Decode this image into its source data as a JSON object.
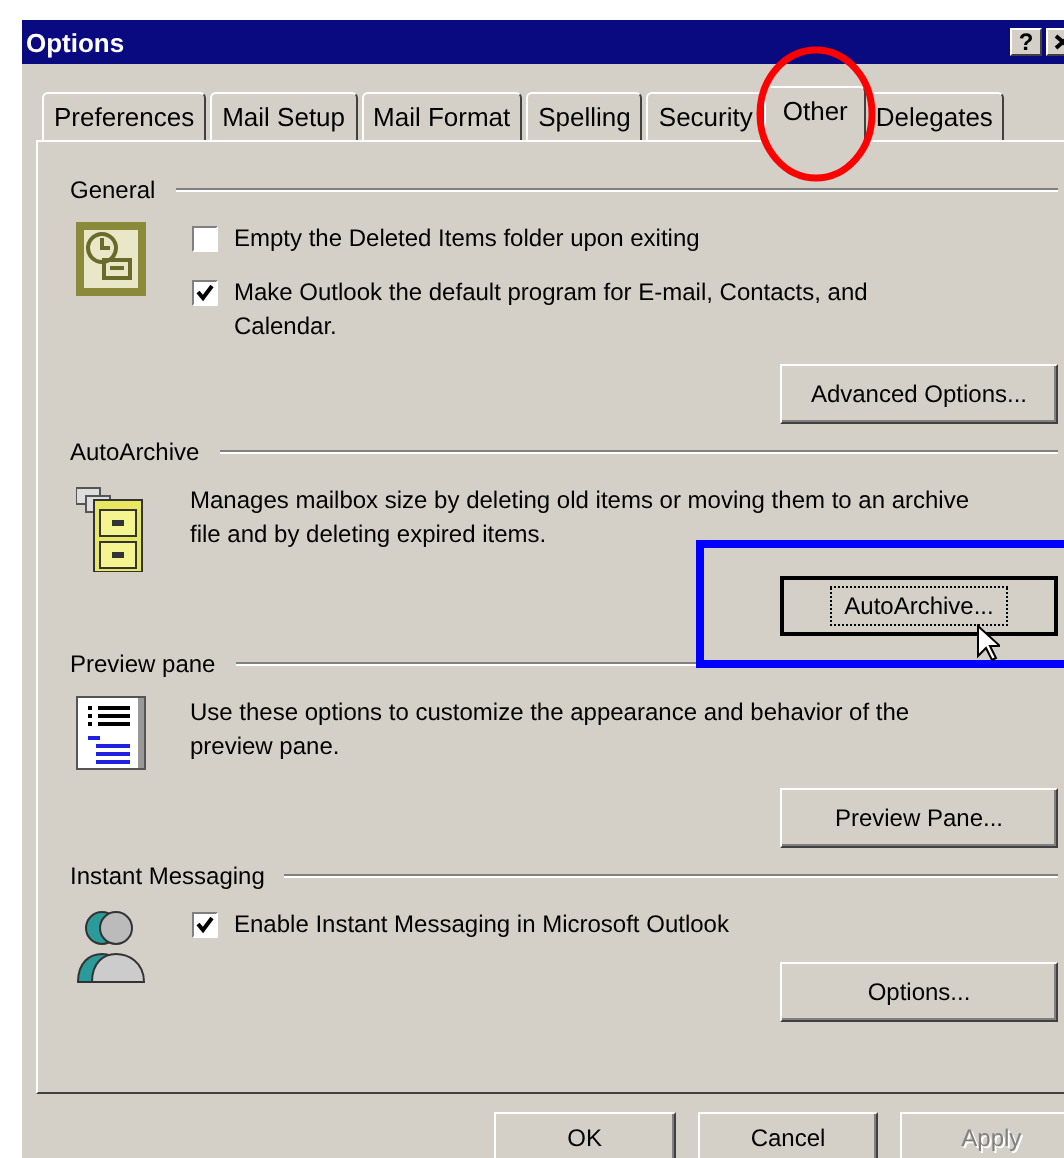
{
  "window": {
    "title": "Options",
    "help_button": "?"
  },
  "tabs": [
    {
      "label": "Preferences",
      "selected": false
    },
    {
      "label": "Mail Setup",
      "selected": false
    },
    {
      "label": "Mail Format",
      "selected": false
    },
    {
      "label": "Spelling",
      "selected": false
    },
    {
      "label": "Security",
      "selected": false
    },
    {
      "label": "Other",
      "selected": true
    },
    {
      "label": "Delegates",
      "selected": false
    }
  ],
  "sections": [
    {
      "title": "General",
      "items": [
        {
          "kind": "checkbox",
          "label": "Empty the Deleted Items folder upon exiting",
          "checked": false
        },
        {
          "kind": "checkbox",
          "label": "Make Outlook the default program for E-mail, Contacts, and Calendar.",
          "checked": true
        }
      ],
      "button": "Advanced Options..."
    },
    {
      "title": "AutoArchive",
      "items": [
        {
          "kind": "text",
          "label": "Manages mailbox size by deleting old items or moving them to an archive file and by deleting expired items."
        }
      ],
      "button": "AutoArchive...",
      "button_focused": true
    },
    {
      "title": "Preview pane",
      "items": [
        {
          "kind": "text",
          "label": "Use these options to customize the appearance and behavior of the preview pane."
        }
      ],
      "button": "Preview Pane..."
    },
    {
      "title": "Instant Messaging",
      "items": [
        {
          "kind": "checkbox",
          "label": "Enable Instant Messaging in Microsoft Outlook",
          "checked": true
        }
      ],
      "button": "Options..."
    }
  ],
  "footer_buttons": [
    {
      "label": "OK",
      "disabled": false
    },
    {
      "label": "Cancel",
      "disabled": false
    },
    {
      "label": "Apply",
      "disabled": true
    }
  ],
  "annotations": [
    {
      "kind": "ellipse",
      "color": "#ff0000"
    },
    {
      "kind": "rectangle",
      "color": "#0000ff"
    }
  ]
}
